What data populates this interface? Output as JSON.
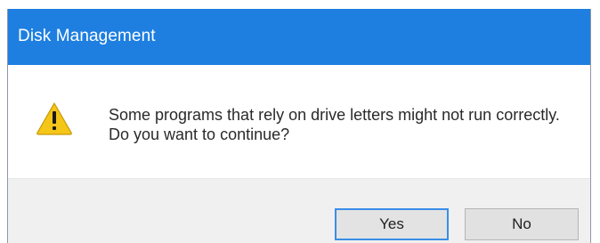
{
  "dialog": {
    "title": "Disk Management",
    "icon": "warning-icon",
    "message": "Some programs that rely on drive letters might not run correctly. Do you want to continue?",
    "buttons": {
      "yes_label": "Yes",
      "no_label": "No"
    }
  },
  "colors": {
    "titlebar": "#1e7fe0",
    "title_text": "#ffffff",
    "warning_fill": "#f5c518",
    "default_button_border": "#3a8ee6",
    "footer": "#f0f0f0"
  }
}
